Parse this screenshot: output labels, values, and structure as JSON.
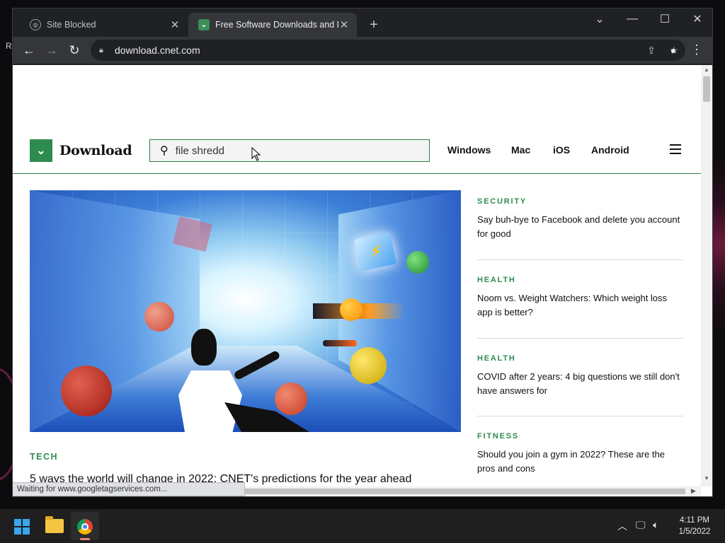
{
  "desktop": {
    "stray_text": "R"
  },
  "browser": {
    "tabs": [
      {
        "title": "Site Blocked",
        "favicon": "globe-icon",
        "active": false
      },
      {
        "title": "Free Software Downloads and Re",
        "favicon": "download-logo-icon",
        "active": true
      }
    ],
    "new_tab_label": "+",
    "url": "download.cnet.com",
    "status_text": "Waiting for www.googletagservices.com..."
  },
  "site": {
    "logo_text": "Download",
    "search": {
      "value": "file shredd"
    },
    "nav": [
      "Windows",
      "Mac",
      "iOS",
      "Android"
    ],
    "hero": {
      "category": "TECH",
      "headline": "5 ways the world will change in 2022: CNET's predictions for the year ahead"
    },
    "sidebar": [
      {
        "category": "SECURITY",
        "headline": "Say buh-bye to Facebook and delete you account for good"
      },
      {
        "category": "HEALTH",
        "headline": "Noom vs. Weight Watchers: Which weight loss app is better?"
      },
      {
        "category": "HEALTH",
        "headline": "COVID after 2 years: 4 big questions we still don't have answers for"
      },
      {
        "category": "FITNESS",
        "headline": "Should you join a gym in 2022? These are the pros and cons"
      }
    ],
    "colors": {
      "brand_green": "#2e8b4f"
    }
  },
  "taskbar": {
    "time": "4:11 PM",
    "date": "1/5/2022"
  }
}
